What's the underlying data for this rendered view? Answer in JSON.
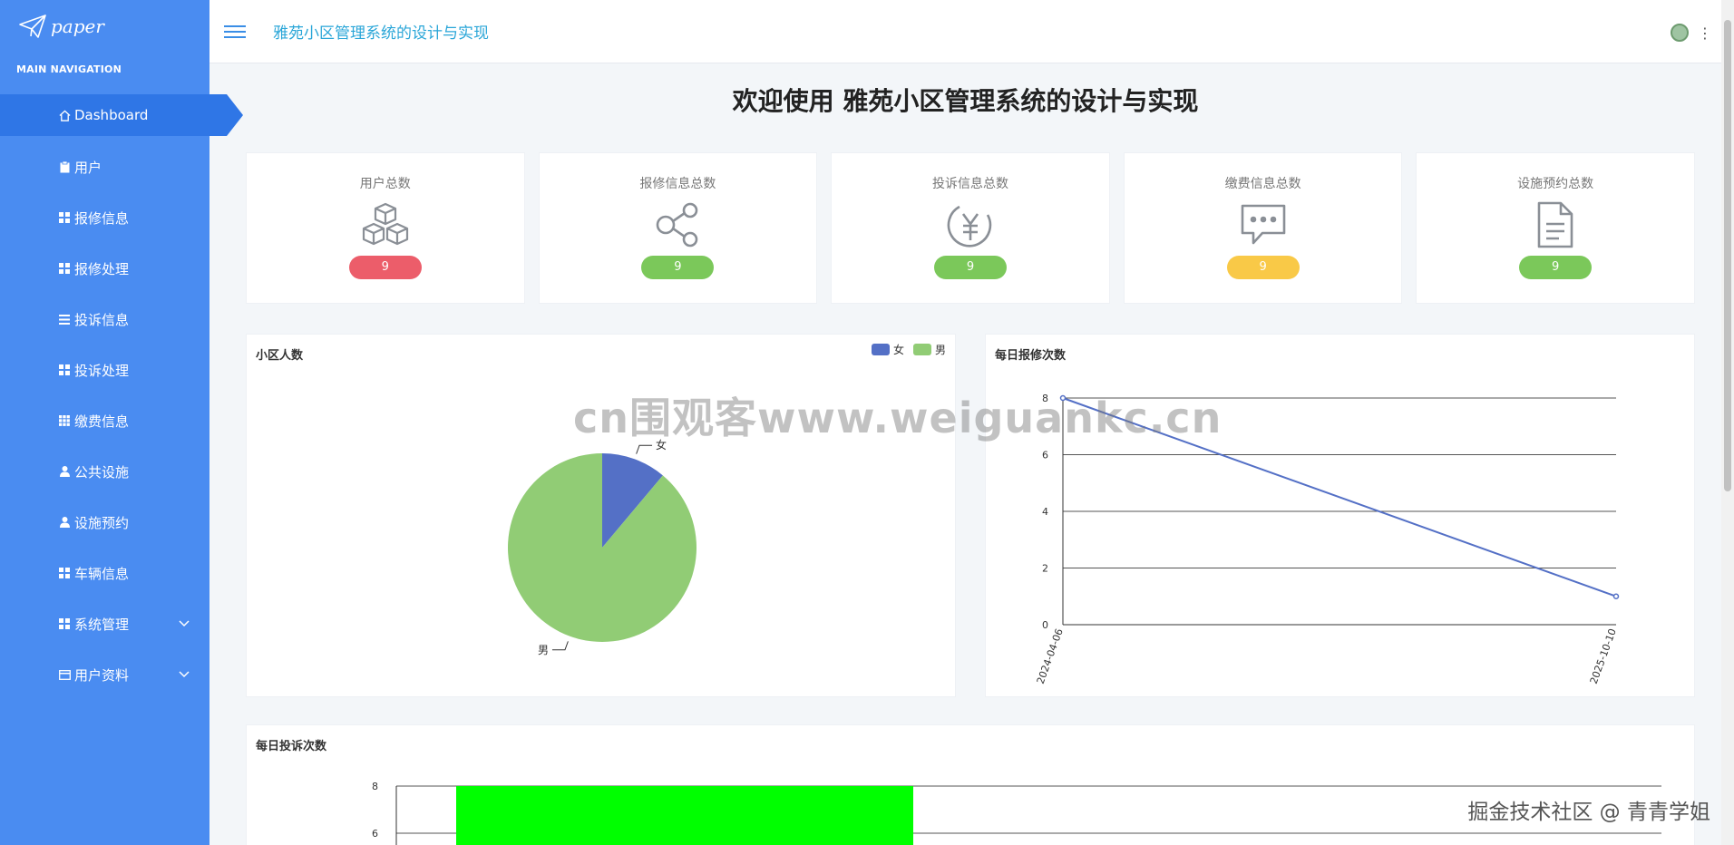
{
  "brand": {
    "name": "paper"
  },
  "sidebar": {
    "header": "MAIN NAVIGATION",
    "items": [
      {
        "label": "Dashboard",
        "icon": "home-icon"
      },
      {
        "label": "用户",
        "icon": "clipboard-icon"
      },
      {
        "label": "报修信息",
        "icon": "grid-icon"
      },
      {
        "label": "报修处理",
        "icon": "grid-icon"
      },
      {
        "label": "投诉信息",
        "icon": "list-icon"
      },
      {
        "label": "投诉处理",
        "icon": "grid-icon"
      },
      {
        "label": "缴费信息",
        "icon": "table-icon"
      },
      {
        "label": "公共设施",
        "icon": "user-icon"
      },
      {
        "label": "设施预约",
        "icon": "user-icon"
      },
      {
        "label": "车辆信息",
        "icon": "grid-icon"
      },
      {
        "label": "系统管理",
        "icon": "grid-icon",
        "chevron": true
      },
      {
        "label": "用户资料",
        "icon": "card-icon",
        "chevron": true
      }
    ]
  },
  "topbar": {
    "title": "雅苑小区管理系统的设计与实现"
  },
  "welcome": "欢迎使用 雅苑小区管理系统的设计与实现",
  "cards": [
    {
      "label": "用户总数",
      "value": "9",
      "color": "#ec5d6a",
      "icon": "cubes-icon"
    },
    {
      "label": "报修信息总数",
      "value": "9",
      "color": "#7bc85a",
      "icon": "share-icon"
    },
    {
      "label": "投诉信息总数",
      "value": "9",
      "color": "#7bc85a",
      "icon": "yen-icon"
    },
    {
      "label": "缴费信息总数",
      "value": "9",
      "color": "#f9c947",
      "icon": "chat-icon"
    },
    {
      "label": "设施预约总数",
      "value": "9",
      "color": "#7bc85a",
      "icon": "document-icon"
    }
  ],
  "charts": {
    "pie_title": "小区人数",
    "line_title": "每日报修次数",
    "bar_title": "每日投诉次数"
  },
  "chart_data": [
    {
      "type": "pie",
      "title": "小区人数",
      "legend": [
        "女",
        "男"
      ],
      "legend_position": "top-right",
      "slices": [
        {
          "name": "女",
          "value": 1,
          "color": "#5470c6"
        },
        {
          "name": "男",
          "value": 8,
          "color": "#91cc75"
        }
      ]
    },
    {
      "type": "line",
      "title": "每日报修次数",
      "x": [
        "2024-04-06",
        "2025-10-10"
      ],
      "y": [
        8,
        1
      ],
      "ylim": [
        0,
        8
      ],
      "yticks": [
        0,
        2,
        4,
        6,
        8
      ],
      "color": "#5470c6",
      "grid": true
    },
    {
      "type": "bar",
      "title": "每日投诉次数",
      "yticks": [
        6,
        8
      ],
      "values": [
        8
      ],
      "color": "#00ff00",
      "grid": true
    }
  ],
  "watermarks": {
    "center": "cn围观客www.weiguankc.cn",
    "footer": "掘金技术社区 @ 青青学姐"
  }
}
